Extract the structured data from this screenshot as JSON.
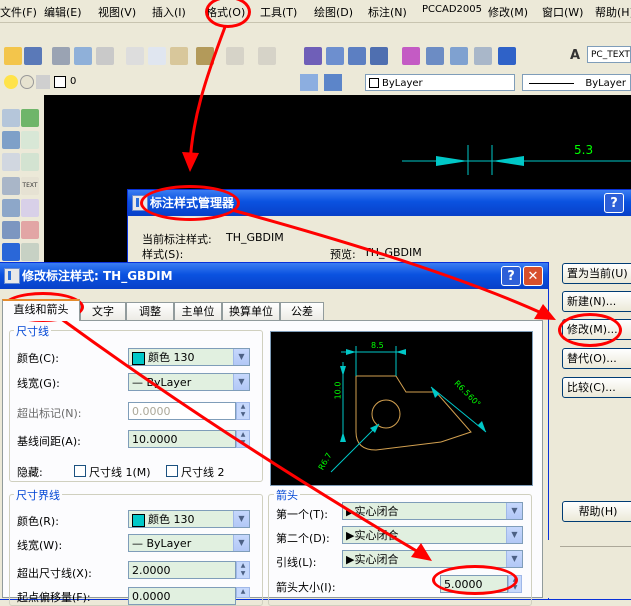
{
  "menu": {
    "items": [
      "文件(F)",
      "编辑(E)",
      "视图(V)",
      "插入(I)",
      "格式(O)",
      "工具(T)",
      "绘图(D)",
      "标注(N)",
      "PCCAD2005",
      "修改(M)",
      "窗口(W)",
      "帮助(H)"
    ],
    "font_label": "PC_TEXTS"
  },
  "toolbar": {
    "layer_value": "0",
    "color_value": "ByLayer",
    "linetype_value": "ByLayer"
  },
  "canvas": {
    "dimension_value": "5.3"
  },
  "manager": {
    "title": "标注样式管理器",
    "current_style_label": "当前标注样式:",
    "current_style_value": "TH_GBDIM",
    "styles_label": "样式(S):",
    "preview_label": "预览:",
    "preview_value": "TH_GBDIM",
    "buttons": {
      "set_current": "置为当前(U)",
      "new": "新建(N)...",
      "modify": "修改(M)...",
      "override": "替代(O)...",
      "compare": "比较(C)...",
      "help": "帮助(H)"
    }
  },
  "modify": {
    "title": "修改标注样式: TH_GBDIM",
    "tabs": [
      "直线和箭头",
      "文字",
      "调整",
      "主单位",
      "换算单位",
      "公差"
    ],
    "dimline": {
      "title": "尺寸线",
      "color_label": "颜色(C):",
      "color_value": "颜色 130",
      "linewidth_label": "线宽(G):",
      "linewidth_value": "— ByLayer",
      "extend_label": "超出标记(N):",
      "extend_value": "0.0000",
      "baseline_label": "基线间距(A):",
      "baseline_value": "10.0000",
      "suppress_label": "隐藏:",
      "suppress_1": "尺寸线 1(M)",
      "suppress_2": "尺寸线 2"
    },
    "extline": {
      "title": "尺寸界线",
      "color_label": "颜色(R):",
      "color_value": "颜色 130",
      "linewidth_label": "线宽(W):",
      "linewidth_value": "— ByLayer",
      "beyond_label": "超出尺寸线(X):",
      "beyond_value": "2.0000",
      "offset_label": "起点偏移量(F):",
      "offset_value": "0.0000"
    },
    "arrows": {
      "title": "箭头",
      "first_label": "第一个(T):",
      "first_value": "实心闭合",
      "second_label": "第二个(D):",
      "second_value": "实心闭合",
      "leader_label": "引线(L):",
      "leader_value": "实心闭合",
      "size_label": "箭头大小(I):",
      "size_value": "5.0000"
    },
    "preview_dims": {
      "top": "8.5",
      "left": "10.0",
      "diag1": "R6.5",
      "diag2": "60°",
      "bottom": "R6.7"
    }
  },
  "colors": {
    "dim_cyan": "#00c8c8",
    "dim_green": "#00ff00",
    "annotation_red": "#ff0000",
    "xp_blue": "#0a52e0"
  }
}
